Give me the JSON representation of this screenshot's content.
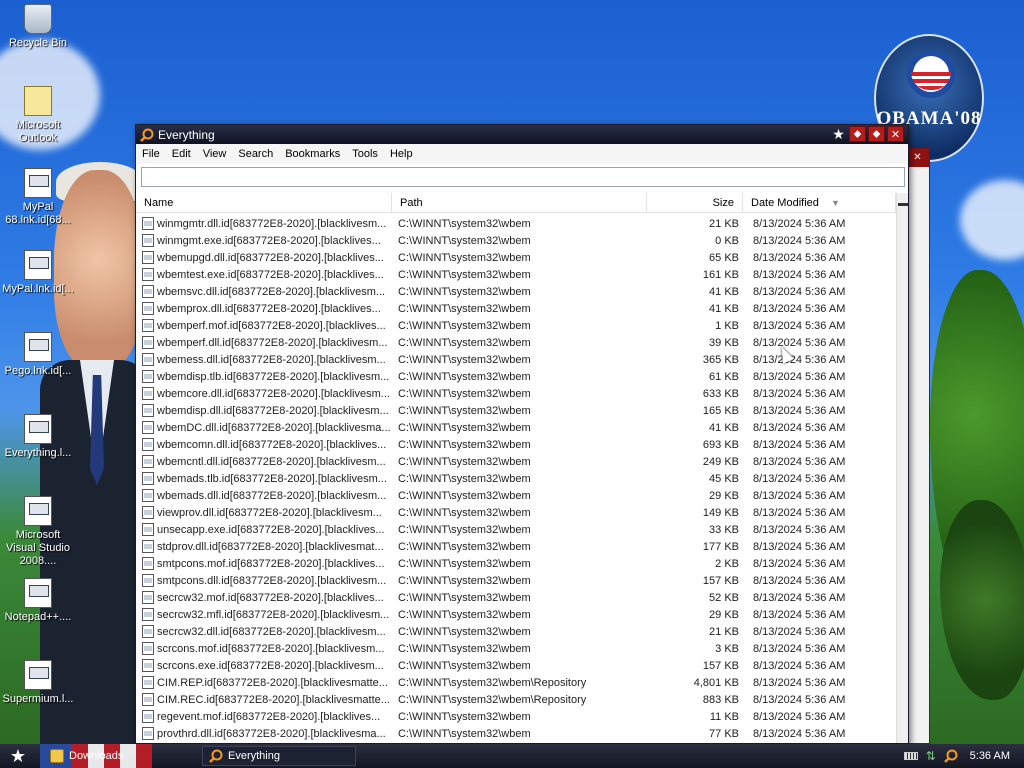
{
  "desktop": {
    "icons": [
      {
        "label": "Recycle Bin"
      },
      {
        "label": "Microsoft Outlook"
      },
      {
        "label": "MyPal 68.lnk.id[68..."
      },
      {
        "label": "MyPal.lnk.id[..."
      },
      {
        "label": "Pego.lnk.id[..."
      },
      {
        "label": "Everything.l..."
      },
      {
        "label": "Microsoft Visual Studio 2008...."
      },
      {
        "label": "Notepad++...."
      },
      {
        "label": "Supermium.l..."
      }
    ],
    "badge_text": "OBAMA'08"
  },
  "window": {
    "title": "Everything",
    "menu": [
      "File",
      "Edit",
      "View",
      "Search",
      "Bookmarks",
      "Tools",
      "Help"
    ],
    "search_value": "",
    "columns": {
      "name": "Name",
      "path": "Path",
      "size": "Size",
      "date": "Date Modified"
    },
    "rows": [
      {
        "name": "winmgmtr.dll.id[683772E8-2020].[blacklivesm...",
        "path": "C:\\WINNT\\system32\\wbem",
        "size": "21 KB",
        "date": "8/13/2024 5:36 AM"
      },
      {
        "name": "winmgmt.exe.id[683772E8-2020].[blacklives...",
        "path": "C:\\WINNT\\system32\\wbem",
        "size": "0 KB",
        "date": "8/13/2024 5:36 AM"
      },
      {
        "name": "wbemupgd.dll.id[683772E8-2020].[blacklives...",
        "path": "C:\\WINNT\\system32\\wbem",
        "size": "65 KB",
        "date": "8/13/2024 5:36 AM"
      },
      {
        "name": "wbemtest.exe.id[683772E8-2020].[blacklives...",
        "path": "C:\\WINNT\\system32\\wbem",
        "size": "161 KB",
        "date": "8/13/2024 5:36 AM"
      },
      {
        "name": "wbemsvc.dll.id[683772E8-2020].[blacklivesm...",
        "path": "C:\\WINNT\\system32\\wbem",
        "size": "41 KB",
        "date": "8/13/2024 5:36 AM"
      },
      {
        "name": "wbemprox.dll.id[683772E8-2020].[blacklives...",
        "path": "C:\\WINNT\\system32\\wbem",
        "size": "41 KB",
        "date": "8/13/2024 5:36 AM"
      },
      {
        "name": "wbemperf.mof.id[683772E8-2020].[blacklives...",
        "path": "C:\\WINNT\\system32\\wbem",
        "size": "1 KB",
        "date": "8/13/2024 5:36 AM"
      },
      {
        "name": "wbemperf.dll.id[683772E8-2020].[blacklivesm...",
        "path": "C:\\WINNT\\system32\\wbem",
        "size": "39 KB",
        "date": "8/13/2024 5:36 AM"
      },
      {
        "name": "wbemess.dll.id[683772E8-2020].[blacklivesm...",
        "path": "C:\\WINNT\\system32\\wbem",
        "size": "365 KB",
        "date": "8/13/2024 5:36 AM"
      },
      {
        "name": "wbemdisp.tlb.id[683772E8-2020].[blacklivesm...",
        "path": "C:\\WINNT\\system32\\wbem",
        "size": "61 KB",
        "date": "8/13/2024 5:36 AM"
      },
      {
        "name": "wbemcore.dll.id[683772E8-2020].[blacklivesm...",
        "path": "C:\\WINNT\\system32\\wbem",
        "size": "633 KB",
        "date": "8/13/2024 5:36 AM"
      },
      {
        "name": "wbemdisp.dll.id[683772E8-2020].[blacklivesm...",
        "path": "C:\\WINNT\\system32\\wbem",
        "size": "165 KB",
        "date": "8/13/2024 5:36 AM"
      },
      {
        "name": "wbemDC.dll.id[683772E8-2020].[blacklivesma...",
        "path": "C:\\WINNT\\system32\\wbem",
        "size": "41 KB",
        "date": "8/13/2024 5:36 AM"
      },
      {
        "name": "wbemcomn.dll.id[683772E8-2020].[blacklives...",
        "path": "C:\\WINNT\\system32\\wbem",
        "size": "693 KB",
        "date": "8/13/2024 5:36 AM"
      },
      {
        "name": "wbemcntl.dll.id[683772E8-2020].[blacklivesm...",
        "path": "C:\\WINNT\\system32\\wbem",
        "size": "249 KB",
        "date": "8/13/2024 5:36 AM"
      },
      {
        "name": "wbemads.tlb.id[683772E8-2020].[blacklivesm...",
        "path": "C:\\WINNT\\system32\\wbem",
        "size": "45 KB",
        "date": "8/13/2024 5:36 AM"
      },
      {
        "name": "wbemads.dll.id[683772E8-2020].[blacklivesm...",
        "path": "C:\\WINNT\\system32\\wbem",
        "size": "29 KB",
        "date": "8/13/2024 5:36 AM"
      },
      {
        "name": "viewprov.dll.id[683772E8-2020].[blacklivesm...",
        "path": "C:\\WINNT\\system32\\wbem",
        "size": "149 KB",
        "date": "8/13/2024 5:36 AM"
      },
      {
        "name": "unsecapp.exe.id[683772E8-2020].[blacklives...",
        "path": "C:\\WINNT\\system32\\wbem",
        "size": "33 KB",
        "date": "8/13/2024 5:36 AM"
      },
      {
        "name": "stdprov.dll.id[683772E8-2020].[blacklivesmat...",
        "path": "C:\\WINNT\\system32\\wbem",
        "size": "177 KB",
        "date": "8/13/2024 5:36 AM"
      },
      {
        "name": "smtpcons.mof.id[683772E8-2020].[blacklives...",
        "path": "C:\\WINNT\\system32\\wbem",
        "size": "2 KB",
        "date": "8/13/2024 5:36 AM"
      },
      {
        "name": "smtpcons.dll.id[683772E8-2020].[blacklivesm...",
        "path": "C:\\WINNT\\system32\\wbem",
        "size": "157 KB",
        "date": "8/13/2024 5:36 AM"
      },
      {
        "name": "secrcw32.mof.id[683772E8-2020].[blacklives...",
        "path": "C:\\WINNT\\system32\\wbem",
        "size": "52 KB",
        "date": "8/13/2024 5:36 AM"
      },
      {
        "name": "secrcw32.mfl.id[683772E8-2020].[blacklivesm...",
        "path": "C:\\WINNT\\system32\\wbem",
        "size": "29 KB",
        "date": "8/13/2024 5:36 AM"
      },
      {
        "name": "secrcw32.dll.id[683772E8-2020].[blacklivesm...",
        "path": "C:\\WINNT\\system32\\wbem",
        "size": "21 KB",
        "date": "8/13/2024 5:36 AM"
      },
      {
        "name": "scrcons.mof.id[683772E8-2020].[blacklivesm...",
        "path": "C:\\WINNT\\system32\\wbem",
        "size": "3 KB",
        "date": "8/13/2024 5:36 AM"
      },
      {
        "name": "scrcons.exe.id[683772E8-2020].[blacklivesm...",
        "path": "C:\\WINNT\\system32\\wbem",
        "size": "157 KB",
        "date": "8/13/2024 5:36 AM"
      },
      {
        "name": "CIM.REP.id[683772E8-2020].[blacklivesmatte...",
        "path": "C:\\WINNT\\system32\\wbem\\Repository",
        "size": "4,801 KB",
        "date": "8/13/2024 5:36 AM"
      },
      {
        "name": "CIM.REC.id[683772E8-2020].[blacklivesmatte...",
        "path": "C:\\WINNT\\system32\\wbem\\Repository",
        "size": "883 KB",
        "date": "8/13/2024 5:36 AM"
      },
      {
        "name": "regevent.mof.id[683772E8-2020].[blacklives...",
        "path": "C:\\WINNT\\system32\\wbem",
        "size": "11 KB",
        "date": "8/13/2024 5:36 AM"
      },
      {
        "name": "provthrd.dll.id[683772E8-2020].[blacklivesma...",
        "path": "C:\\WINNT\\system32\\wbem",
        "size": "77 KB",
        "date": "8/13/2024 5:36 AM"
      }
    ]
  },
  "taskbar": {
    "tasks": [
      {
        "label": "Downloads"
      },
      {
        "label": "Everything"
      }
    ],
    "clock": "5:36 AM"
  },
  "colors": {
    "titlebar": "#0f1222",
    "close_button": "#b51c1c",
    "taskbar": "#121522"
  }
}
